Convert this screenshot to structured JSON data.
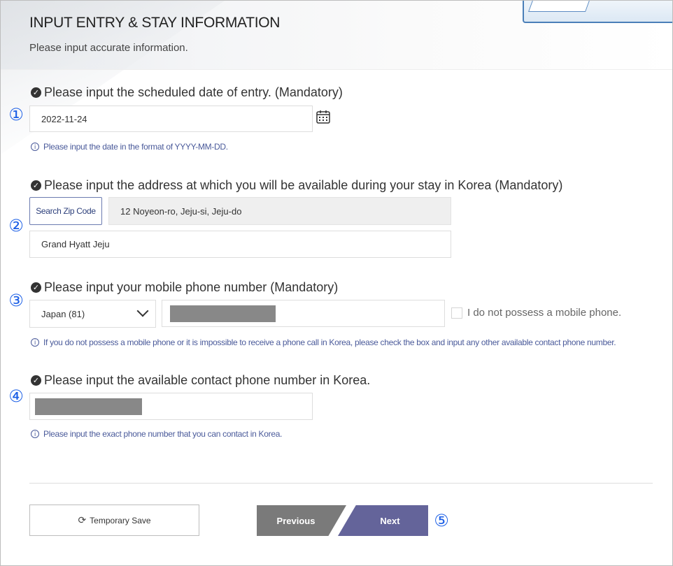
{
  "header": {
    "title": "INPUT ENTRY & STAY INFORMATION",
    "subtitle": "Please input accurate information."
  },
  "entry_date": {
    "marker": "①",
    "label": "Please input the scheduled date of entry. (Mandatory)",
    "value": "2022-11-24",
    "hint": "Please input the date in the format of YYYY-MM-DD."
  },
  "address": {
    "marker": "②",
    "label": "Please input the address at which you will be available during your stay in Korea (Mandatory)",
    "zip_button": "Search Zip Code",
    "address_line1": "12 Noyeon-ro, Jeju-si, Jeju-do",
    "address_line2": "Grand Hyatt Jeju"
  },
  "mobile": {
    "marker": "③",
    "label": "Please input your mobile phone number (Mandatory)",
    "country_code": "Japan (81)",
    "no_phone_label": "I do not possess a mobile phone.",
    "hint": "If you do not possess a mobile phone or it is impossible to receive a phone call in Korea, please check the box and input any other available contact phone number."
  },
  "contact": {
    "marker": "④",
    "label": "Please input the available contact phone number in Korea.",
    "hint": "Please input the exact phone number that you can contact in Korea."
  },
  "footer": {
    "temporary_save": "Temporary Save",
    "previous": "Previous",
    "next": "Next",
    "marker": "⑤"
  },
  "colors": {
    "accent_marker": "#1a5ee6",
    "hint_text": "#4a5a9a",
    "next_button": "#64649a",
    "previous_button": "#7a7a7a"
  },
  "icons": [
    "check-circle-icon",
    "info-icon",
    "calendar-icon",
    "chevron-down-icon",
    "refresh-icon"
  ]
}
